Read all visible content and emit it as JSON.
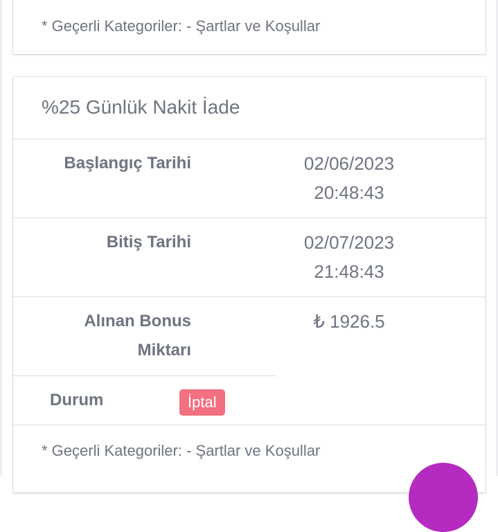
{
  "top_card": {
    "footnote": "* Geçerli Kategoriler: - Şartlar ve Koşullar"
  },
  "bonus_card": {
    "title": "%25 Günlük Nakit İade",
    "rows": [
      {
        "label": "Başlangıç Tarihi",
        "value_line1": "02/06/2023",
        "value_line2": "20:48:43"
      },
      {
        "label": "Bitiş Tarihi",
        "value_line1": "02/07/2023",
        "value_line2": "21:48:43"
      },
      {
        "label_line1": "Alınan Bonus",
        "label_line2": "Miktarı",
        "value": "₺ 1926.5"
      }
    ],
    "status": {
      "label": "Durum",
      "badge": "İptal",
      "badge_color": "#f2707f"
    },
    "footnote": "* Geçerli Kategoriler: - Şartlar ve Koşullar"
  },
  "fab": {
    "color": "#b52bc0"
  }
}
